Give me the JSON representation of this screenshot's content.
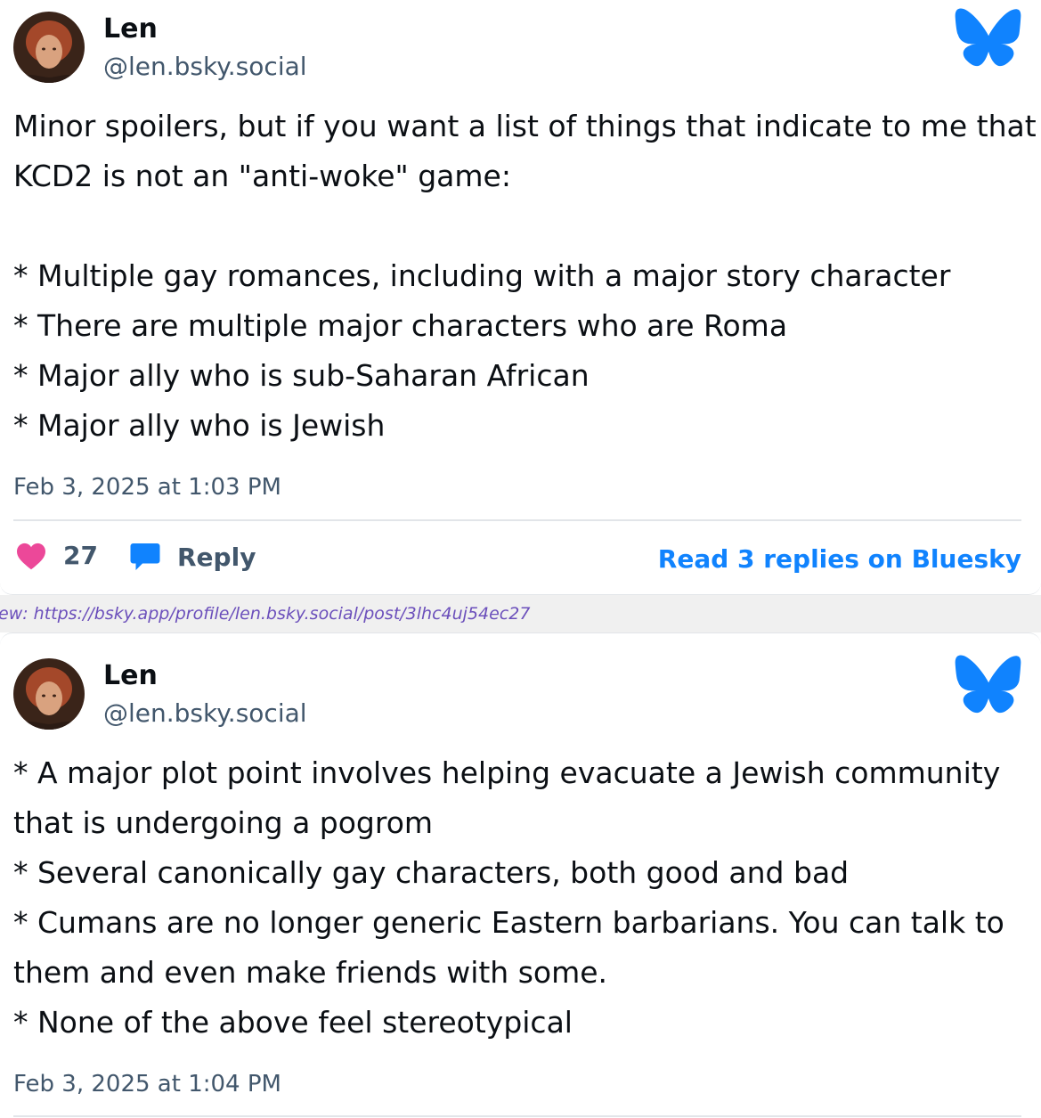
{
  "posts": [
    {
      "author": {
        "name": "Len",
        "handle": "@len.bsky.social"
      },
      "lines": [
        "Minor spoilers, but if you want a list of things that indicate to me that",
        "KCD2 is not an \"anti-woke\" game:",
        "",
        "* Multiple gay romances, including with a major story character",
        "* There are multiple major characters who are Roma",
        "* Major ally who is sub-Saharan African",
        "* Major ally who is Jewish"
      ],
      "timestamp": "Feb 3, 2025 at 1:03 PM",
      "likes": "27",
      "reply_label": "Reply",
      "read_replies": "Read 3 replies on Bluesky"
    },
    {
      "author": {
        "name": "Len",
        "handle": "@len.bsky.social"
      },
      "lines": [
        "* A major plot point involves helping evacuate a Jewish community",
        "that is undergoing a pogrom",
        "* Several canonically gay characters, both good and bad",
        "* Cumans are no longer generic Eastern barbarians. You can talk to",
        "them and even make friends with some.",
        "* None of the above feel stereotypical"
      ],
      "timestamp": "Feb 3, 2025 at 1:04 PM"
    }
  ],
  "url_bar": {
    "text": "ew: https://bsky.app/profile/len.bsky.social/post/3lhc4uj54ec27"
  },
  "colors": {
    "like_heart": "#ec4899",
    "reply_bubble": "#1083fe",
    "bluesky_logo": "#1083fe",
    "link": "#1083fe",
    "secondary_text": "#42576c"
  },
  "icons": [
    "avatar",
    "bluesky-butterfly-icon",
    "heart-icon",
    "reply-bubble-icon"
  ]
}
